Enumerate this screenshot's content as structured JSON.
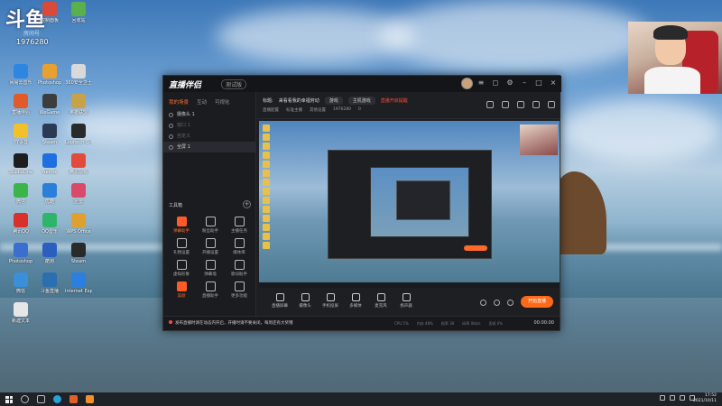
{
  "desktop": {
    "logo": "斗鱼",
    "room_label": "房间号",
    "room_id": "1976280",
    "icons": [
      {
        "label": "此电脑",
        "color": "#4a90d9"
      },
      {
        "label": "控制面板",
        "color": "#d94a3a"
      },
      {
        "label": "回收站",
        "color": "#59b04c"
      },
      {
        "label": "网易云音乐",
        "color": "#2d86e0"
      },
      {
        "label": "Photoshop",
        "color": "#e8a030"
      },
      {
        "label": "360安全卫士",
        "color": "#d9d9d9"
      },
      {
        "label": "直播伴侣",
        "color": "#e05a2a"
      },
      {
        "label": "WeGame",
        "color": "#3d3d3d"
      },
      {
        "label": "英雄联盟",
        "color": "#c8a248"
      },
      {
        "label": "YY语音",
        "color": "#f2c12a"
      },
      {
        "label": "Steam",
        "color": "#2a3a55"
      },
      {
        "label": "Logitech G HUB",
        "color": "#2a2a2a"
      },
      {
        "label": "StudioOne",
        "color": "#1e1e1e"
      },
      {
        "label": "Netflix",
        "color": "#1f6fe0"
      },
      {
        "label": "腾讯视频",
        "color": "#e24a3a"
      },
      {
        "label": "微信",
        "color": "#3bb54a"
      },
      {
        "label": "优酷",
        "color": "#2a7fd9"
      },
      {
        "label": "迅雷",
        "color": "#d94a6a"
      },
      {
        "label": "腾讯QQ",
        "color": "#d9302a"
      },
      {
        "label": "QQ音乐",
        "color": "#2fb56a"
      },
      {
        "label": "WPS Office",
        "color": "#e0a030"
      },
      {
        "label": "Photoshop",
        "color": "#3a6fd0"
      },
      {
        "label": "酷狗",
        "color": "#2a5fc0"
      },
      {
        "label": "Steam",
        "color": "#2a2a2a"
      },
      {
        "label": "微信",
        "color": "#3a8fd9"
      },
      {
        "label": "斗鱼直播",
        "color": "#2a6fb0"
      },
      {
        "label": "Internet Explorer",
        "color": "#2a7fe0"
      },
      {
        "label": "新建文本",
        "color": "#e6e6e6"
      }
    ]
  },
  "app": {
    "logo": "直播伴侣",
    "version": "测试版",
    "tabs": [
      "我的场景",
      "互动",
      "可视化"
    ],
    "scenes": [
      {
        "label": "摄像头 1",
        "state": "normal"
      },
      {
        "label": "窗口 1",
        "state": "dim"
      },
      {
        "label": "自定义",
        "state": "dim"
      },
      {
        "label": "全屏 1",
        "state": "selected"
      }
    ],
    "tools_header": "工具箱",
    "tools": [
      {
        "label": "弹幕助手",
        "hot": true
      },
      {
        "label": "粉丝助手",
        "hot": false
      },
      {
        "label": "主播任务",
        "hot": false
      },
      {
        "label": "礼物设置",
        "hot": false
      },
      {
        "label": "开播设置",
        "hot": false
      },
      {
        "label": "媒体库",
        "hot": false
      },
      {
        "label": "虚拟形象",
        "hot": false
      },
      {
        "label": "弹幕墙",
        "hot": false
      },
      {
        "label": "歌词助手",
        "hot": false
      },
      {
        "label": "美颜",
        "hot": true
      },
      {
        "label": "直播助手",
        "hot": false
      },
      {
        "label": "更多功能",
        "hot": false
      }
    ],
    "info": {
      "title_label": "标题:",
      "title_value": "来看看我的幸福劳动",
      "category_tag": "游戏",
      "subcategory": "主机游戏",
      "notice": "直播开启提醒",
      "row2": [
        "直播配置",
        "标准主播",
        "其他设置",
        "1976280"
      ],
      "counter": "0"
    },
    "controls": [
      {
        "label": "直播屏幕"
      },
      {
        "label": "摄像头"
      },
      {
        "label": "手机投屏"
      },
      {
        "label": "多媒体"
      },
      {
        "label": "麦克风"
      },
      {
        "label": "扬声器"
      }
    ],
    "live_button": "开始直播",
    "status": {
      "message": "发布直播时请在动态内开启，开播时请不要关闭，每周还有大奖哦",
      "stats": [
        "CPU 5%",
        "内存 48%",
        "帧率 30",
        "码率 0kb/s",
        "丢帧 0%"
      ],
      "time": "00:00:00"
    }
  },
  "taskbar": {
    "time": "17:52",
    "date": "2021/10/11"
  }
}
